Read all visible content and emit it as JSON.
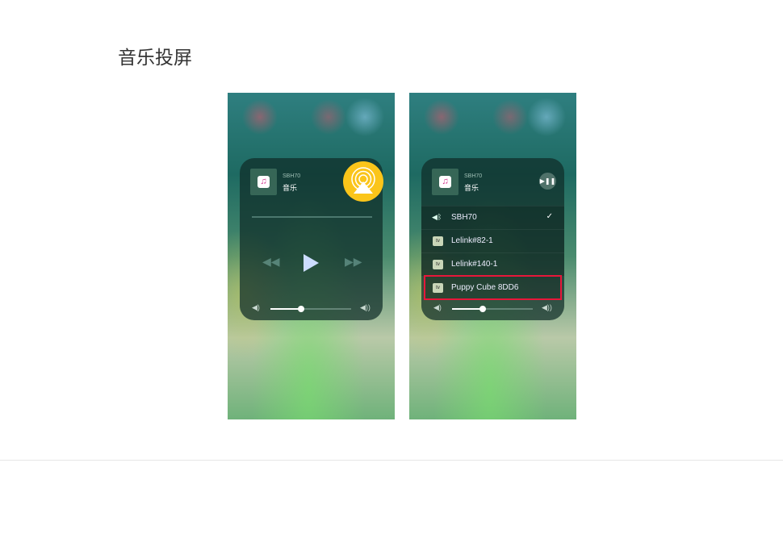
{
  "page": {
    "title": "音乐投屏"
  },
  "screens": [
    {
      "device": "SBH70",
      "song": "音乐",
      "icons": {
        "album": "music-note-icon",
        "airplay": "airplay-icon"
      },
      "volume_fraction": 0.38,
      "airplay_color": "#fbc51a"
    },
    {
      "device": "SBH70",
      "song": "音乐",
      "volume_fraction": 0.38,
      "outputs": [
        {
          "label": "SBH70",
          "icon": "bluetooth-speaker-icon",
          "checked": true,
          "check": "✓"
        },
        {
          "label": "Lelink#82-1",
          "icon": "apple-tv-icon"
        },
        {
          "label": "Lelink#140-1",
          "icon": "apple-tv-icon"
        },
        {
          "label": "Puppy Cube 8DD6",
          "icon": "apple-tv-icon",
          "highlighted": true,
          "highlight_color": "#e8173a"
        }
      ]
    }
  ]
}
